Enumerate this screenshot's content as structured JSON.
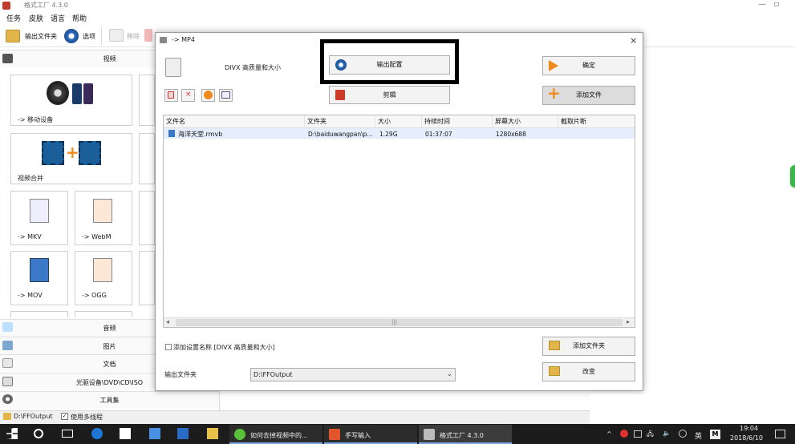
{
  "window": {
    "title": "格式工厂 4.3.0",
    "controls": [
      "—",
      "▫"
    ]
  },
  "menu": [
    "任务",
    "皮肤",
    "语言",
    "帮助"
  ],
  "toolbar": {
    "output_folder": "输出文件夹",
    "options": "选项",
    "remove": "移除"
  },
  "left_panel": {
    "video_header": "视频",
    "tiles": [
      {
        "label": "-> 移动设备"
      },
      {
        "label": "视频合并"
      },
      {
        "label": "-> MKV"
      },
      {
        "label": "-> WebM"
      },
      {
        "label": "-> MOV"
      },
      {
        "label": "-> OGG"
      }
    ],
    "categories": [
      "音频",
      "图片",
      "文档",
      "光驱设备\\DVD\\CD\\ISO",
      "工具集"
    ]
  },
  "dialog": {
    "title": "-> MP4",
    "preset": "DIVX 高质量和大小",
    "output_config": "输出配置",
    "edit": "剪辑",
    "ok": "确定",
    "add_file": "添加文件",
    "add_folder": "添加文件夹",
    "change": "改变",
    "add_setting_name": "添加设置名称 [DIVX 高质量和大小]",
    "output_folder_label": "输出文件夹",
    "output_folder_value": "D:\\FFOutput",
    "columns": [
      "文件名",
      "文件夹",
      "大小",
      "持续时间",
      "屏幕大小",
      "截取片断"
    ],
    "rows": [
      {
        "name": "海洋天堂.rmvb",
        "folder": "D:\\baiduwangpan\\p...",
        "size": "1.29G",
        "duration": "01:37:07",
        "screen": "1280x688",
        "clip": ""
      }
    ],
    "scroll_mid": "|||"
  },
  "statusbar": {
    "path": "D:\\FFOutput",
    "multithread": "使用多线程"
  },
  "taskbar": {
    "items": [
      {
        "label": "如何去掉视频中的..."
      },
      {
        "label": "手写输入"
      },
      {
        "label": "格式工厂 4.3.0"
      }
    ],
    "ime": "英",
    "ime2": "M",
    "time": "19:04",
    "date": "2018/6/10"
  },
  "colors": {
    "highlight_box": "#000000",
    "taskbar_bg": "#1c1c1c",
    "plus_orange": "#f08a1c",
    "file_badge": "#3c78c8"
  }
}
